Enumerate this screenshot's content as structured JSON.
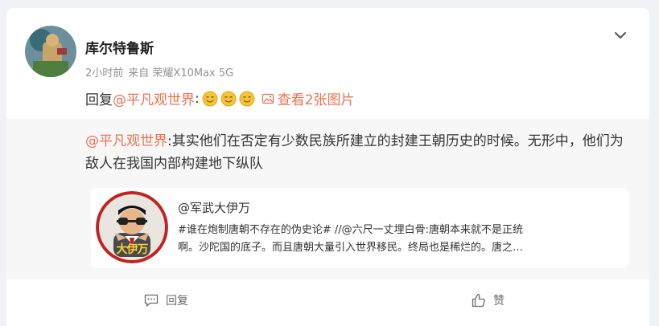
{
  "post": {
    "author": "库尔特鲁斯",
    "time": "2小时前",
    "source": "来自 荣耀X10Max 5G",
    "reply_prefix": "回复",
    "mention": "@平凡观世界",
    "colon": ":",
    "view_images": "查看2张图片",
    "repost": {
      "mention": "@平凡观世界",
      "text": ":其实他们在否定有少数民族所建立的封建王朝历史的时候。无形中，他们为敌人在我国内部构建地下纵队"
    },
    "embed": {
      "author": "@军武大伊万",
      "line1": "#谁在炮制唐朝不存在的伪史论# //@六尺一丈埋白骨:唐朝本来就不是正统",
      "line2": "啊。沙陀国的底子。而且唐朝大量引入世界移民。终局也是稀烂的。唐之…",
      "avatar_badge": "大伊万"
    },
    "actions": {
      "reply": "回复",
      "like": "赞"
    }
  },
  "icons": [
    "chevron-down-icon",
    "smile-emoji-icon",
    "image-icon",
    "comment-icon",
    "thumbs-up-icon"
  ],
  "colors": {
    "accent": "#eb7350",
    "background": "#f1f2f5",
    "card": "#ffffff",
    "repost_bg": "#f7f7f7"
  }
}
